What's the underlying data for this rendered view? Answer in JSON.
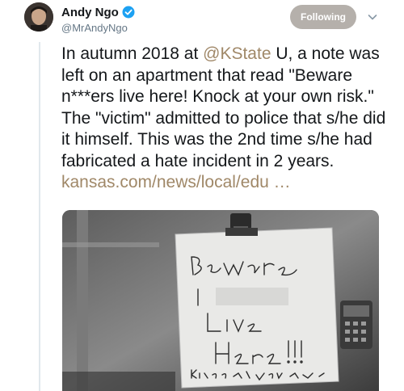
{
  "author": {
    "display_name": "Andy Ngo",
    "handle": "@MrAndyNgo",
    "verified": true
  },
  "follow_button": {
    "label": "Following"
  },
  "tweet": {
    "text_before_mention": "In autumn 2018 at ",
    "mention": "@KState",
    "text_after_mention": " U, a note was left on an apartment that read \"Beware n***ers live here! Knock at your own risk.\" The \"victim\" admitted to police that s/he did it himself. This was the 2nd time s/he had fabricated a hate incident in 2 years.",
    "link": "kansas.com/news/local/edu …"
  },
  "media": {
    "note_lines": [
      "Beware",
      "Live",
      "Here!!!",
      "Knock at your own risk"
    ]
  },
  "colors": {
    "link": "#a08868",
    "follow_bg": "#b5b0ab",
    "verified": "#1da1f2"
  },
  "icons": {
    "verified": "verified-badge-icon",
    "menu": "chevron-down-icon"
  }
}
